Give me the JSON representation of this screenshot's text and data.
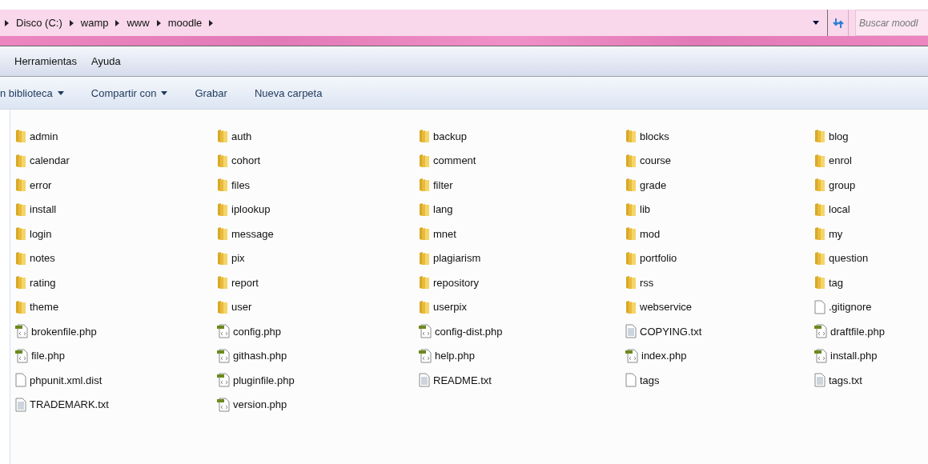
{
  "address_bar": {
    "breadcrumbs": [
      "Disco (C:)",
      "wamp",
      "www",
      "moodle"
    ]
  },
  "search": {
    "placeholder": "Buscar moodl"
  },
  "menu_bar": [
    "Herramientas",
    "Ayuda"
  ],
  "toolbar": [
    {
      "label": "n biblioteca",
      "dropdown": true
    },
    {
      "label": "Compartir con",
      "dropdown": true
    },
    {
      "label": "Grabar",
      "dropdown": false
    },
    {
      "label": "Nueva carpeta",
      "dropdown": false
    }
  ],
  "files": [
    {
      "name": "admin",
      "kind": "folder"
    },
    {
      "name": "auth",
      "kind": "folder"
    },
    {
      "name": "backup",
      "kind": "folder"
    },
    {
      "name": "blocks",
      "kind": "folder"
    },
    {
      "name": "blog",
      "kind": "folder"
    },
    {
      "name": "calendar",
      "kind": "folder"
    },
    {
      "name": "cohort",
      "kind": "folder"
    },
    {
      "name": "comment",
      "kind": "folder"
    },
    {
      "name": "course",
      "kind": "folder"
    },
    {
      "name": "enrol",
      "kind": "folder"
    },
    {
      "name": "error",
      "kind": "folder"
    },
    {
      "name": "files",
      "kind": "folder"
    },
    {
      "name": "filter",
      "kind": "folder"
    },
    {
      "name": "grade",
      "kind": "folder"
    },
    {
      "name": "group",
      "kind": "folder"
    },
    {
      "name": "install",
      "kind": "folder"
    },
    {
      "name": "iplookup",
      "kind": "folder"
    },
    {
      "name": "lang",
      "kind": "folder"
    },
    {
      "name": "lib",
      "kind": "folder"
    },
    {
      "name": "local",
      "kind": "folder"
    },
    {
      "name": "login",
      "kind": "folder"
    },
    {
      "name": "message",
      "kind": "folder"
    },
    {
      "name": "mnet",
      "kind": "folder"
    },
    {
      "name": "mod",
      "kind": "folder"
    },
    {
      "name": "my",
      "kind": "folder"
    },
    {
      "name": "notes",
      "kind": "folder"
    },
    {
      "name": "pix",
      "kind": "folder"
    },
    {
      "name": "plagiarism",
      "kind": "folder"
    },
    {
      "name": "portfolio",
      "kind": "folder"
    },
    {
      "name": "question",
      "kind": "folder"
    },
    {
      "name": "rating",
      "kind": "folder"
    },
    {
      "name": "report",
      "kind": "folder"
    },
    {
      "name": "repository",
      "kind": "folder"
    },
    {
      "name": "rss",
      "kind": "folder"
    },
    {
      "name": "tag",
      "kind": "folder"
    },
    {
      "name": "theme",
      "kind": "folder"
    },
    {
      "name": "user",
      "kind": "folder"
    },
    {
      "name": "userpix",
      "kind": "folder"
    },
    {
      "name": "webservice",
      "kind": "folder"
    },
    {
      "name": ".gitignore",
      "kind": "file"
    },
    {
      "name": "brokenfile.php",
      "kind": "php"
    },
    {
      "name": "config.php",
      "kind": "php"
    },
    {
      "name": "config-dist.php",
      "kind": "php"
    },
    {
      "name": "COPYING.txt",
      "kind": "text"
    },
    {
      "name": "draftfile.php",
      "kind": "php"
    },
    {
      "name": "file.php",
      "kind": "php"
    },
    {
      "name": "githash.php",
      "kind": "php"
    },
    {
      "name": "help.php",
      "kind": "php"
    },
    {
      "name": "index.php",
      "kind": "php"
    },
    {
      "name": "install.php",
      "kind": "php"
    },
    {
      "name": "phpunit.xml.dist",
      "kind": "file"
    },
    {
      "name": "pluginfile.php",
      "kind": "php"
    },
    {
      "name": "README.txt",
      "kind": "text"
    },
    {
      "name": "tags",
      "kind": "file"
    },
    {
      "name": "tags.txt",
      "kind": "text"
    },
    {
      "name": "TRADEMARK.txt",
      "kind": "text"
    },
    {
      "name": "version.php",
      "kind": "php"
    }
  ]
}
